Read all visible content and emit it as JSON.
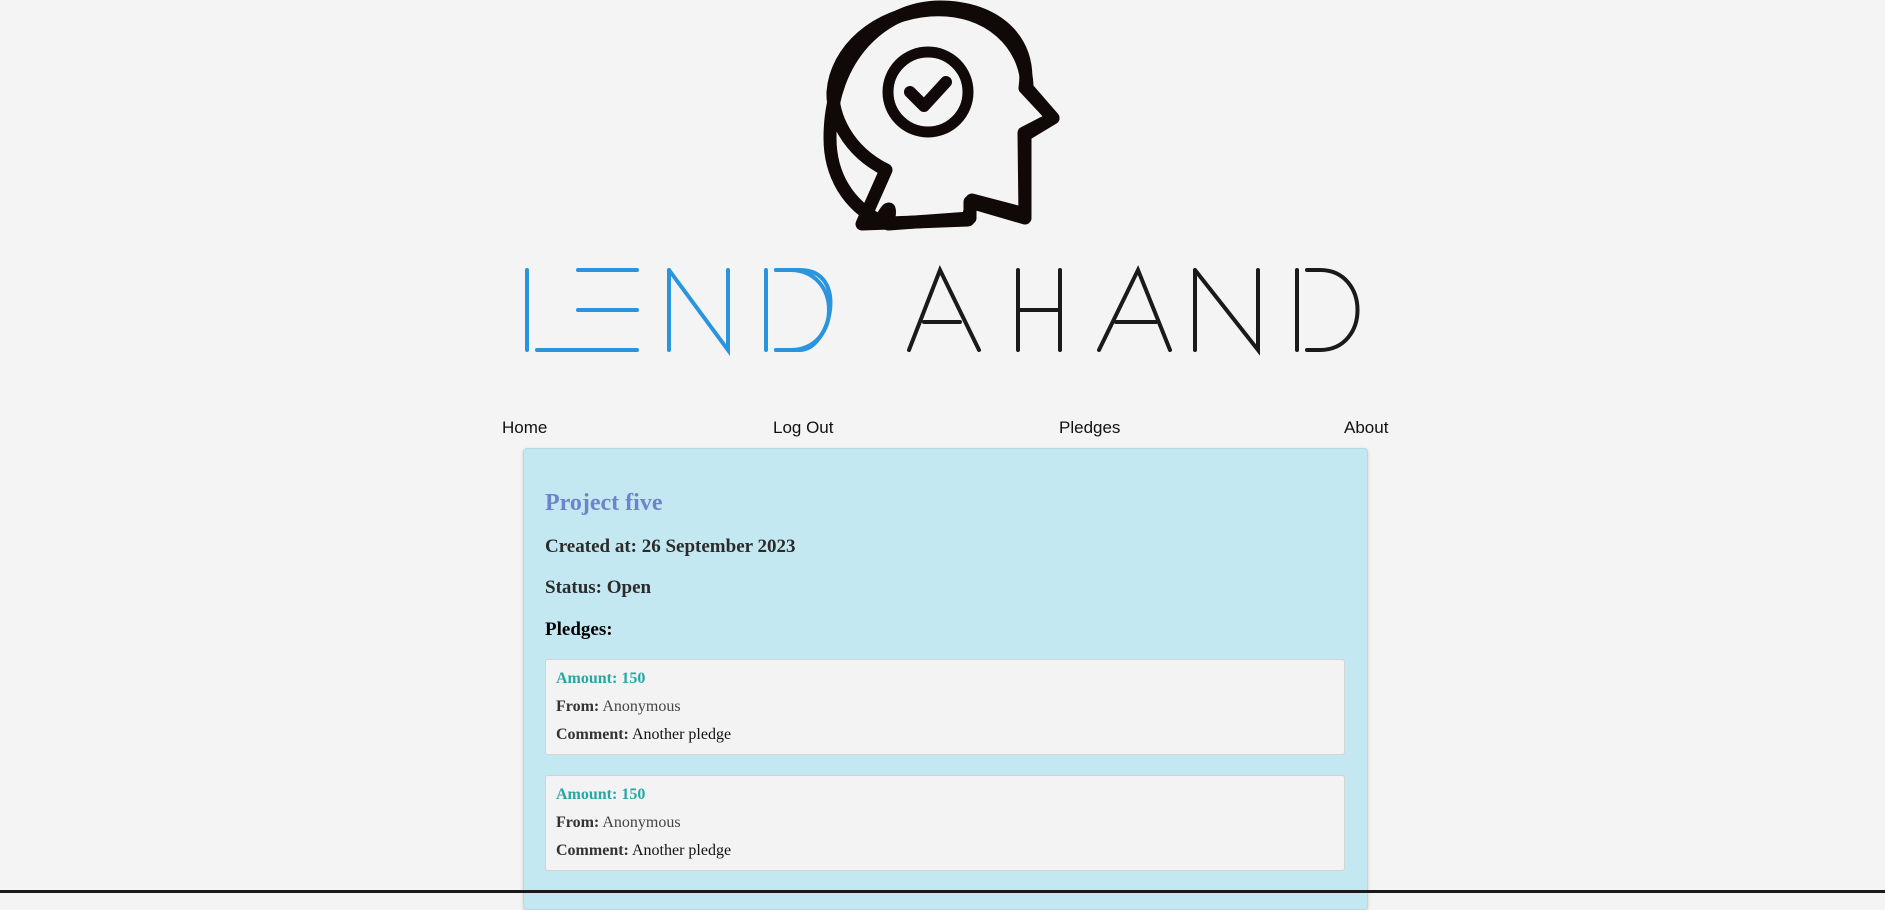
{
  "brand": {
    "name": "LEND AHAND",
    "logo_icon": "head-checkmark-icon",
    "colors": {
      "lend": "#2a94dd",
      "ahand": "#1a1a1a",
      "icon": "#110808"
    }
  },
  "nav": {
    "home": "Home",
    "logout": "Log Out",
    "pledges": "Pledges",
    "about": "About"
  },
  "project": {
    "title": "Project five",
    "created": "Created at: 26 September 2023",
    "status": "Status: Open",
    "pledges_heading": "Pledges:",
    "pledges": [
      {
        "amount": "Amount: 150",
        "from_label": "From:",
        "from": "Anonymous",
        "comment_label": "Comment:",
        "comment": "Another pledge"
      },
      {
        "amount": "Amount: 150",
        "from_label": "From:",
        "from": "Anonymous",
        "comment_label": "Comment:",
        "comment": "Another pledge"
      }
    ]
  }
}
